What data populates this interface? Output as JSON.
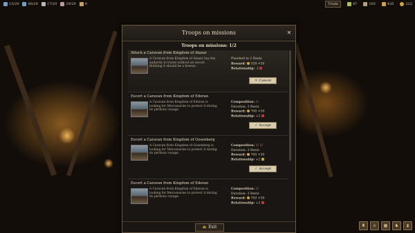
{
  "topbar": {
    "resources": [
      {
        "value": "13/29",
        "icon": "warrior-icon",
        "color": "#6fa0c8"
      },
      {
        "value": "46/29",
        "icon": "helmet-icon",
        "color": "#6fa0c8"
      },
      {
        "value": "17/29",
        "icon": "sword-icon",
        "color": "#b8b8b8"
      },
      {
        "value": "29/29",
        "icon": "banner-icon",
        "color": "#b89aa0"
      },
      {
        "value": "9",
        "icon": "horse-icon",
        "color": "#c8a060"
      }
    ],
    "trade_label": "Trade",
    "right": [
      {
        "value": "47",
        "icon": "food-icon",
        "color": "#a8c060"
      },
      {
        "value": "105",
        "icon": "supplies-icon",
        "color": "#b0a080"
      },
      {
        "value": "435",
        "icon": "renown-icon",
        "color": "#d0a040"
      },
      {
        "value": "222",
        "icon": "gold-icon",
        "color": "#d8a53a"
      }
    ]
  },
  "dialog": {
    "title": "Troops on missions",
    "subtitle": "Troops on missions: 1/2",
    "close_icon": "close-icon",
    "exit_label": "Exit"
  },
  "missions": [
    {
      "title": "Attack a Caravan from Kingdom of Alazar",
      "description": "A Caravan from Kingdom of Alazar has the audacity to travel without an escort. Robbing it should be a breeze.",
      "status": "Finished in 2 Rests",
      "reward_label": "Reward:",
      "reward_gold": "559",
      "reward_rep": "50",
      "relationship_label": "Relationship:",
      "relationship_value": "-1",
      "action": "Cancel",
      "active": true
    },
    {
      "title": "Escort a Caravan from Kingdom of Edoran",
      "description": "A Caravan from Kingdom of Edoran is looking for Mercenaries to protect it during its perilous voyage.",
      "composition_label": "Composition:",
      "composition": "1/",
      "duration": "Duration: 3 Rests",
      "reward_label": "Reward:",
      "reward_gold": "700",
      "reward_rep": "50",
      "relationship_label": "Relationship:",
      "relationship_value": "+2",
      "action": "Accept",
      "active": false
    },
    {
      "title": "Escort a Caravan from Kingdom of Gosenberg",
      "description": "A Caravan from Kingdom of Gosenberg is looking for Mercenaries to protect it during its perilous voyage.",
      "composition_label": "Composition:",
      "composition": "1/  1/",
      "duration": "Duration: 3 Rests",
      "reward_label": "Reward:",
      "reward_gold": "700",
      "reward_rep": "50",
      "relationship_label": "Relationship:",
      "relationship_value": "+2",
      "action": "Accept",
      "active": false
    },
    {
      "title": "Escort a Caravan from Kingdom of Edoran",
      "description": "A Caravan from Kingdom of Edoran is looking for Mercenaries to protect it during its perilous voyage.",
      "composition_label": "Composition:",
      "composition": "1/",
      "duration": "Duration: 3 Rests",
      "reward_label": "Reward:",
      "reward_gold": "700",
      "reward_rep": "50",
      "relationship_label": "Relationship:",
      "relationship_value": "+2",
      "action": "Accept",
      "active": false
    }
  ],
  "bottom_icons": [
    "castle-icon",
    "army-icon",
    "map-icon",
    "quests-icon",
    "hourglass-icon"
  ]
}
